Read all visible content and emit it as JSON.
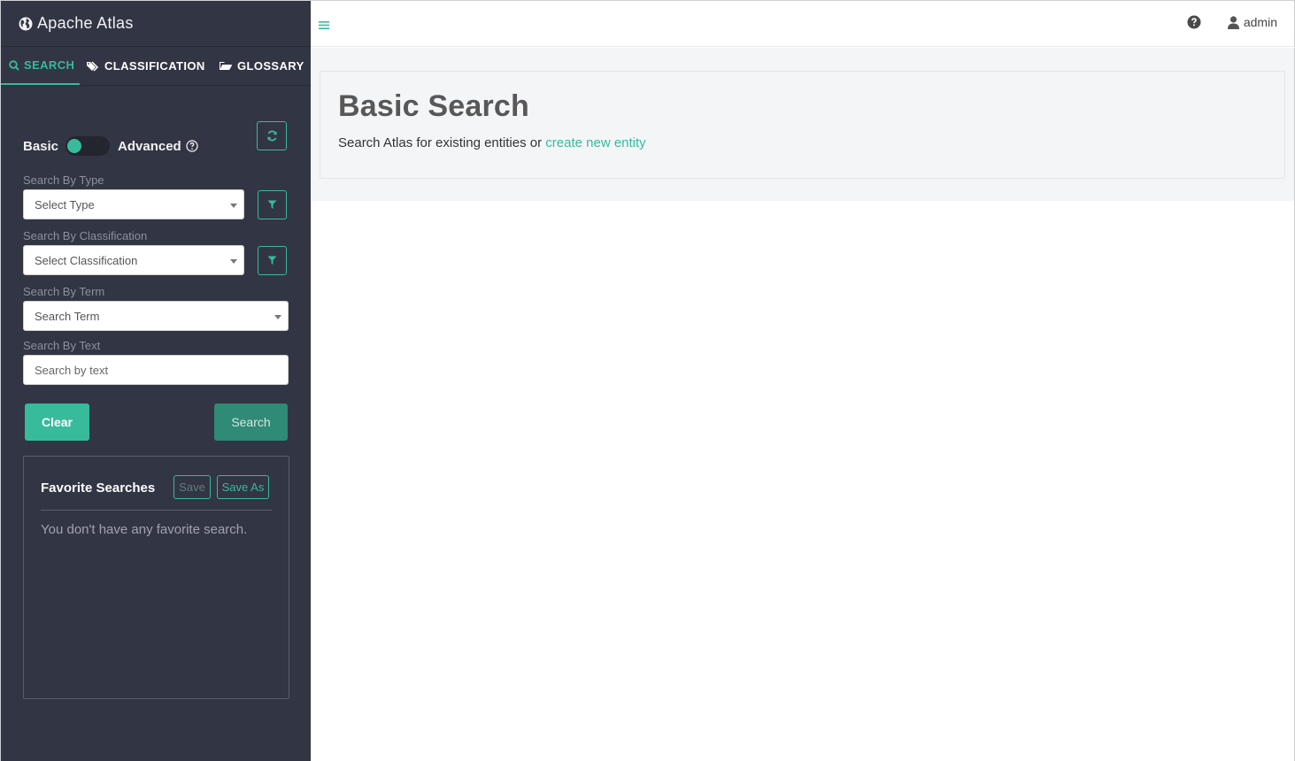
{
  "brand": {
    "title": "Apache Atlas"
  },
  "tabs": [
    {
      "label": "SEARCH",
      "icon": "search-icon",
      "active": true
    },
    {
      "label": "CLASSIFICATION",
      "icon": "tags-icon",
      "active": false
    },
    {
      "label": "GLOSSARY",
      "icon": "folder-open-icon",
      "active": false
    }
  ],
  "search_panel": {
    "mode_basic": "Basic",
    "mode_advanced": "Advanced",
    "toggle_state": "basic",
    "type": {
      "label": "Search By Type",
      "placeholder": "Select Type"
    },
    "classification": {
      "label": "Search By Classification",
      "placeholder": "Select Classification"
    },
    "term": {
      "label": "Search By Term",
      "placeholder": "Search Term"
    },
    "text": {
      "label": "Search By Text",
      "placeholder": "Search by text",
      "value": ""
    },
    "clear_label": "Clear",
    "search_label": "Search"
  },
  "favorites": {
    "title": "Favorite Searches",
    "save_label": "Save",
    "save_as_label": "Save As",
    "empty_message": "You don't have any favorite search."
  },
  "topbar": {
    "user": "admin"
  },
  "main": {
    "heading": "Basic Search",
    "subtitle_prefix": "Search Atlas for existing entities or ",
    "subtitle_link": "create new entity"
  },
  "colors": {
    "accent": "#37bb9b",
    "sidebar_bg": "#323544",
    "main_bg": "#f4f5f7"
  }
}
